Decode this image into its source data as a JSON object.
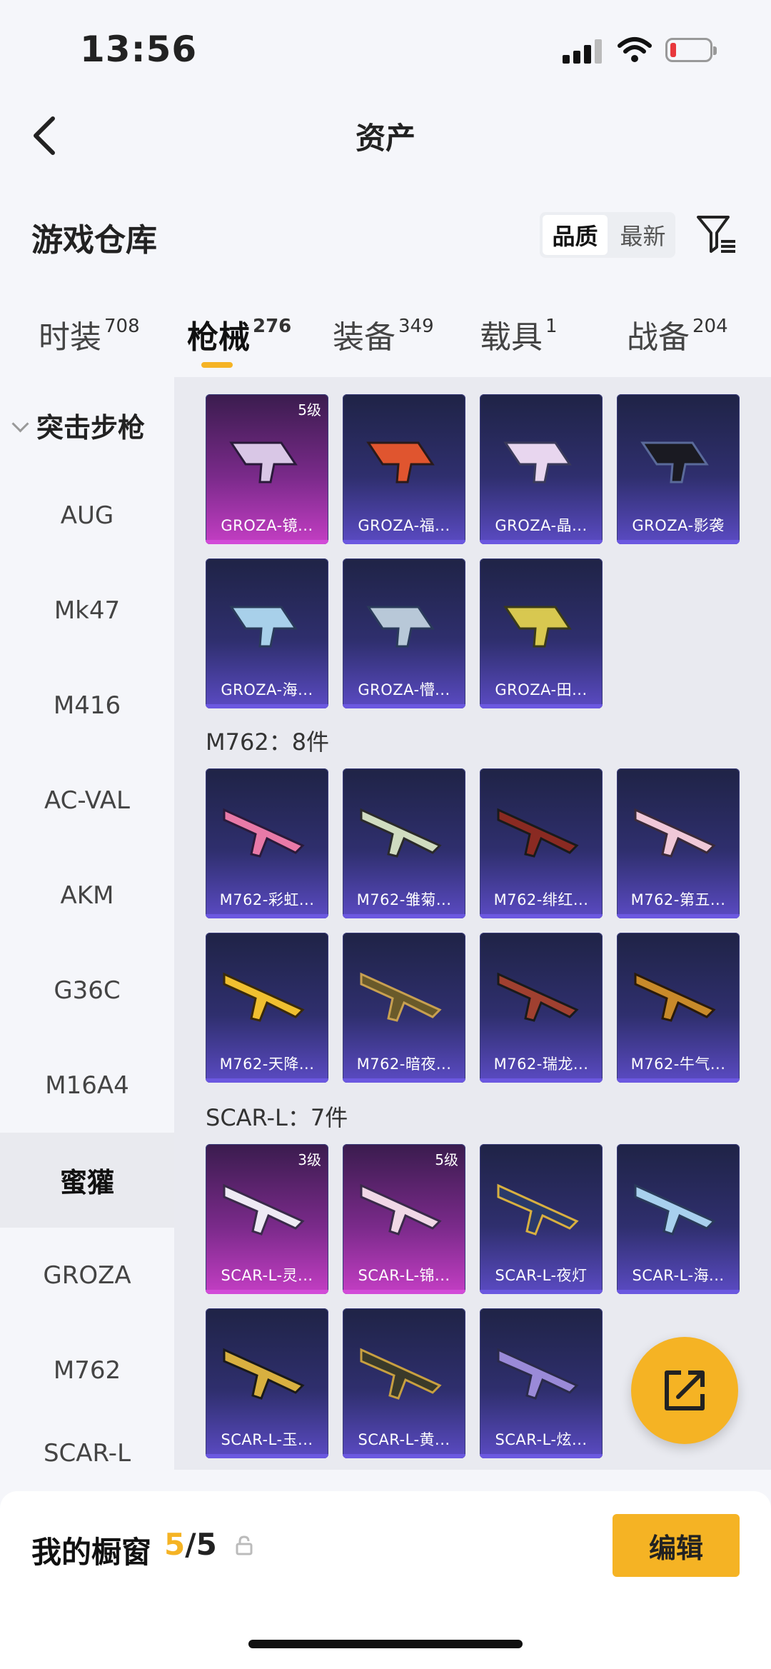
{
  "status": {
    "time": "13:56"
  },
  "header": {
    "title": "资产"
  },
  "warehouse": {
    "title": "游戏仓库",
    "sort": [
      "品质",
      "最新"
    ]
  },
  "tabs": [
    {
      "label": "时装",
      "count": "708"
    },
    {
      "label": "枪械",
      "count": "276"
    },
    {
      "label": "装备",
      "count": "349"
    },
    {
      "label": "载具",
      "count": "1"
    },
    {
      "label": "战备",
      "count": "204"
    }
  ],
  "sidebar": {
    "group": "突击步枪",
    "items": [
      "AUG",
      "Mk47",
      "M416",
      "AC-VAL",
      "AKM",
      "G36C",
      "M16A4",
      "蜜獾",
      "GROZA",
      "M762",
      "SCAR-L"
    ]
  },
  "sections": {
    "m762": "M762：8件",
    "scar": "SCAR-L：7件"
  },
  "cards": [
    {
      "label": "GROZA-镜...",
      "level": "5级"
    },
    {
      "label": "GROZA-福..."
    },
    {
      "label": "GROZA-晶..."
    },
    {
      "label": "GROZA-影袭"
    },
    {
      "label": "GROZA-海..."
    },
    {
      "label": "GROZA-懵..."
    },
    {
      "label": "GROZA-田..."
    },
    {
      "label": "M762-彩虹..."
    },
    {
      "label": "M762-雏菊..."
    },
    {
      "label": "M762-绯红..."
    },
    {
      "label": "M762-第五..."
    },
    {
      "label": "M762-天降..."
    },
    {
      "label": "M762-暗夜..."
    },
    {
      "label": "M762-瑞龙..."
    },
    {
      "label": "M762-牛气..."
    },
    {
      "label": "SCAR-L-灵...",
      "level": "3级"
    },
    {
      "label": "SCAR-L-锦...",
      "level": "5级"
    },
    {
      "label": "SCAR-L-夜灯"
    },
    {
      "label": "SCAR-L-海..."
    },
    {
      "label": "SCAR-L-玉..."
    },
    {
      "label": "SCAR-L-黄..."
    },
    {
      "label": "SCAR-L-炫..."
    }
  ],
  "showcase": {
    "title": "我的橱窗",
    "count_current": "5",
    "count_sep": "/",
    "count_total": "5",
    "edit_label": "编辑"
  },
  "colors": {
    "accent": "#f5b324",
    "card_purple": "#2f2f6e",
    "card_pink": "#7a2a8a"
  },
  "icons": [
    "back-arrow-icon",
    "filter-icon",
    "share-icon",
    "lock-icon"
  ]
}
